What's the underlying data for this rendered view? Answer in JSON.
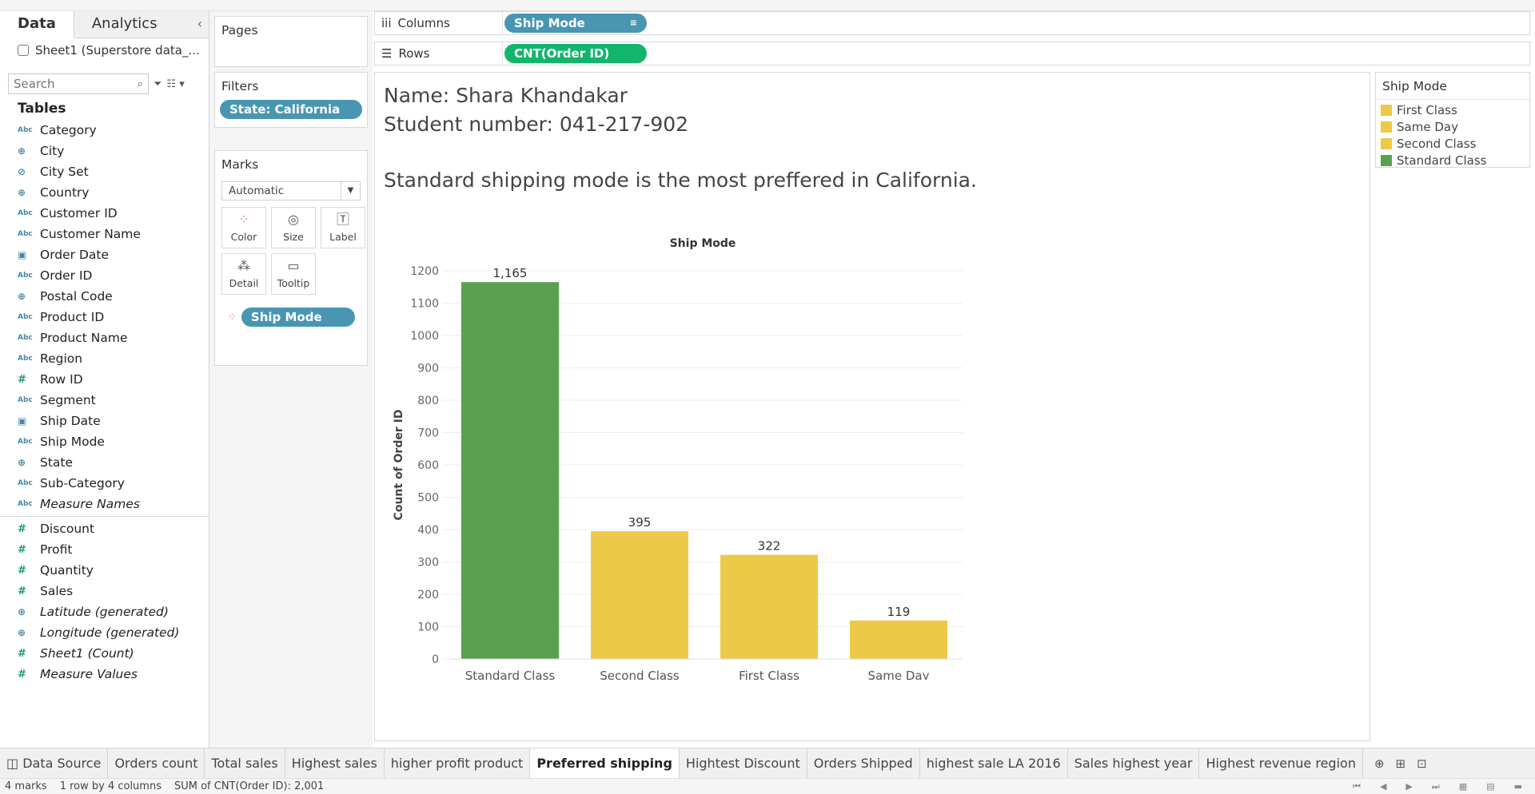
{
  "data_pane": {
    "tab_data": "Data",
    "tab_analytics": "Analytics",
    "datasource": "Sheet1 (Superstore data_...",
    "search_placeholder": "Search",
    "tables_header": "Tables",
    "dimensions": [
      {
        "type": "Abc",
        "name": "Category"
      },
      {
        "type": "geo",
        "name": "City"
      },
      {
        "type": "set",
        "name": "City Set"
      },
      {
        "type": "geo",
        "name": "Country"
      },
      {
        "type": "Abc",
        "name": "Customer ID"
      },
      {
        "type": "Abc",
        "name": "Customer Name"
      },
      {
        "type": "date",
        "name": "Order Date"
      },
      {
        "type": "Abc",
        "name": "Order ID"
      },
      {
        "type": "geo",
        "name": "Postal Code"
      },
      {
        "type": "Abc",
        "name": "Product ID"
      },
      {
        "type": "Abc",
        "name": "Product Name"
      },
      {
        "type": "Abc",
        "name": "Region"
      },
      {
        "type": "#",
        "name": "Row ID"
      },
      {
        "type": "Abc",
        "name": "Segment"
      },
      {
        "type": "date",
        "name": "Ship Date"
      },
      {
        "type": "Abc",
        "name": "Ship Mode"
      },
      {
        "type": "geo",
        "name": "State"
      },
      {
        "type": "Abc",
        "name": "Sub-Category"
      },
      {
        "type": "Abc",
        "name": "Measure Names",
        "italic": true
      }
    ],
    "measures": [
      {
        "type": "#",
        "name": "Discount"
      },
      {
        "type": "#",
        "name": "Profit"
      },
      {
        "type": "#",
        "name": "Quantity"
      },
      {
        "type": "#",
        "name": "Sales"
      },
      {
        "type": "geo",
        "name": "Latitude (generated)",
        "italic": true
      },
      {
        "type": "geo",
        "name": "Longitude (generated)",
        "italic": true
      },
      {
        "type": "#",
        "name": "Sheet1 (Count)",
        "italic": true
      },
      {
        "type": "#",
        "name": "Measure Values",
        "italic": true
      }
    ]
  },
  "pages_card": {
    "title": "Pages"
  },
  "filters_card": {
    "title": "Filters",
    "pill": "State: California"
  },
  "marks_card": {
    "title": "Marks",
    "mark_type": "Automatic",
    "buttons": [
      "Color",
      "Size",
      "Label",
      "Detail",
      "Tooltip"
    ],
    "pill": "Ship Mode"
  },
  "columns_shelf": {
    "label": "Columns",
    "pill": "Ship Mode"
  },
  "rows_shelf": {
    "label": "Rows",
    "pill": "CNT(Order ID)"
  },
  "view": {
    "line1": "Name: Shara Khandakar",
    "line2": "Student number: 041-217-902",
    "line3": "Standard shipping mode is the most preffered in California."
  },
  "chart_data": {
    "type": "bar",
    "title": "Ship Mode",
    "xlabel": "",
    "ylabel": "Count of Order ID",
    "categories": [
      "Standard Class",
      "Second Class",
      "First Class",
      "Same Day"
    ],
    "values": [
      1165,
      395,
      322,
      119
    ],
    "value_labels": [
      "1,165",
      "395",
      "322",
      "119"
    ],
    "colors": [
      "#59a14f",
      "#edc948",
      "#edc948",
      "#edc948"
    ],
    "ylim": [
      0,
      1200
    ],
    "yticks": [
      0,
      100,
      200,
      300,
      400,
      500,
      600,
      700,
      800,
      900,
      1000,
      1100,
      1200
    ],
    "grid": true
  },
  "legend": {
    "title": "Ship Mode",
    "items": [
      {
        "label": "First Class",
        "color": "#edc948"
      },
      {
        "label": "Same Day",
        "color": "#edc948"
      },
      {
        "label": "Second Class",
        "color": "#edc948"
      },
      {
        "label": "Standard Class",
        "color": "#59a14f"
      }
    ]
  },
  "sheet_tabs": {
    "datasource": "Data Source",
    "tabs": [
      "Orders count",
      "Total sales",
      "Highest sales",
      "higher profit product",
      "Preferred shipping",
      "Hightest Discount",
      "Orders Shipped",
      "highest sale LA 2016",
      "Sales highest year",
      "Highest revenue region"
    ],
    "active_index": 4
  },
  "status": {
    "marks": "4 marks",
    "dims": "1 row by 4 columns",
    "sum": "SUM of CNT(Order ID): 2,001"
  }
}
